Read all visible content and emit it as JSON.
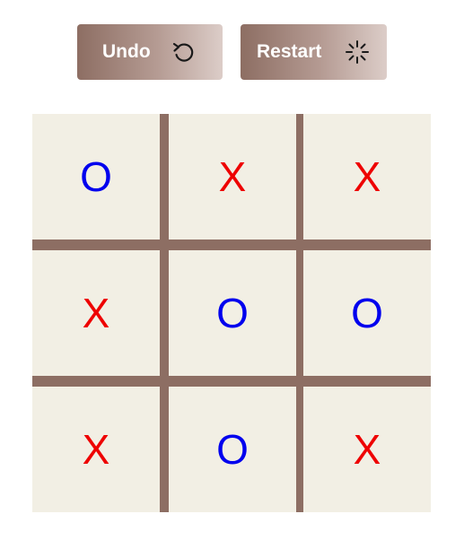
{
  "toolbar": {
    "undo_label": "Undo",
    "undo_icon": "undo-icon",
    "restart_label": "Restart",
    "restart_icon": "spinner-icon"
  },
  "board": {
    "cells": [
      {
        "mark": "O"
      },
      {
        "mark": "X"
      },
      {
        "mark": "X"
      },
      {
        "mark": "X"
      },
      {
        "mark": "O"
      },
      {
        "mark": "O"
      },
      {
        "mark": "X"
      },
      {
        "mark": "O"
      },
      {
        "mark": "X"
      }
    ]
  },
  "colors": {
    "button_gradient_start": "#8d6e63",
    "button_gradient_end": "#dccdc8",
    "grid_line": "#8d6e63",
    "cell_bg": "#f2efe4",
    "x_color": "#ee0000",
    "o_color": "#0000ee"
  }
}
